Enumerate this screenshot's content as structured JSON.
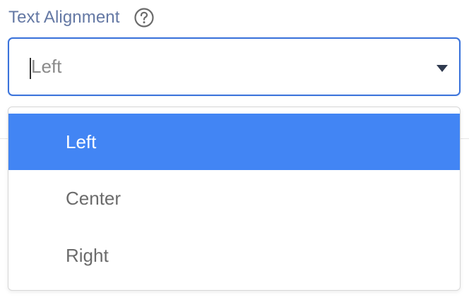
{
  "field": {
    "label": "Text Alignment",
    "help_icon": "question-circle-icon"
  },
  "select": {
    "value": "Left",
    "arrow_icon": "caret-down-icon",
    "options": [
      {
        "label": "Left",
        "selected": true
      },
      {
        "label": "Center",
        "selected": false
      },
      {
        "label": "Right",
        "selected": false
      }
    ]
  },
  "colors": {
    "label": "#6478a4",
    "focus_border": "#3b73db",
    "selected_bg": "#4285f4",
    "option_text": "#6b6b6b",
    "value_text": "#8a8a8a"
  }
}
